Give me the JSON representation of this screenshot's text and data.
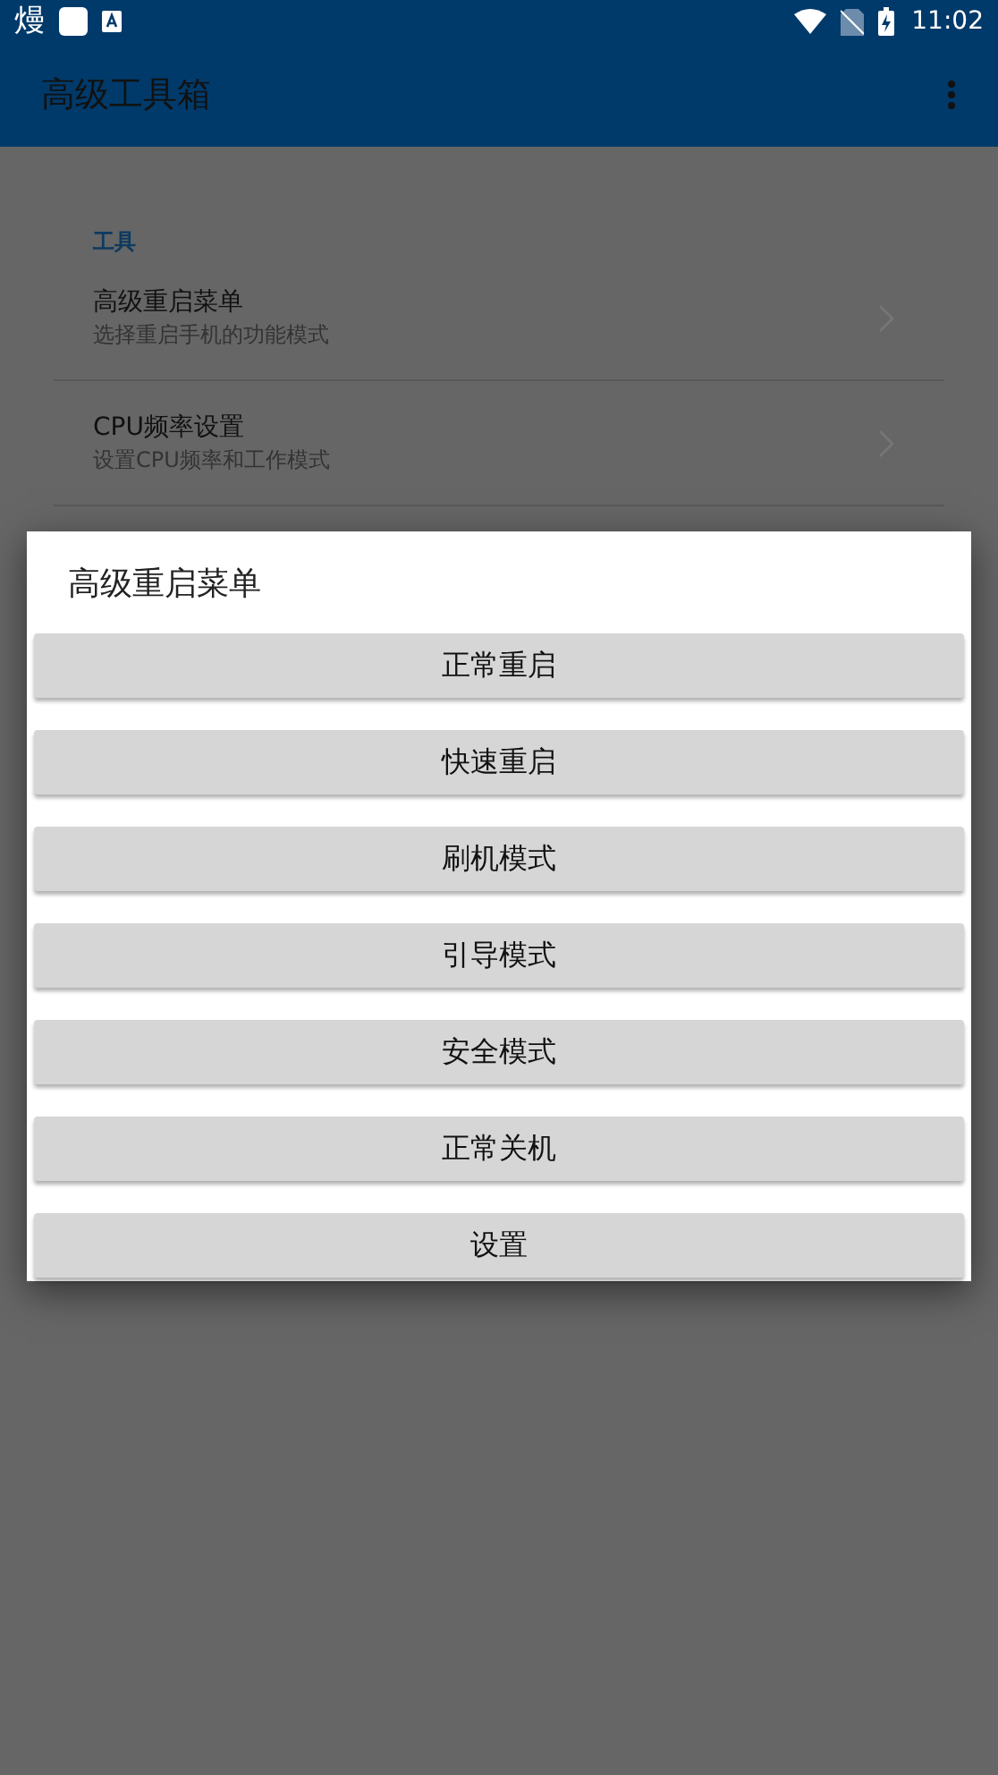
{
  "status_bar": {
    "notification_text": "熳",
    "time": "11:02"
  },
  "app_bar": {
    "title": "高级工具箱"
  },
  "settings": {
    "category": "工具",
    "items": [
      {
        "title": "高级重启菜单",
        "summary": "选择重启手机的功能模式"
      },
      {
        "title": "CPU频率设置",
        "summary": "设置CPU频率和工作模式"
      }
    ]
  },
  "dialog": {
    "title": "高级重启菜单",
    "buttons": [
      "正常重启",
      "快速重启",
      "刷机模式",
      "引导模式",
      "安全模式",
      "正常关机",
      "设置"
    ]
  }
}
